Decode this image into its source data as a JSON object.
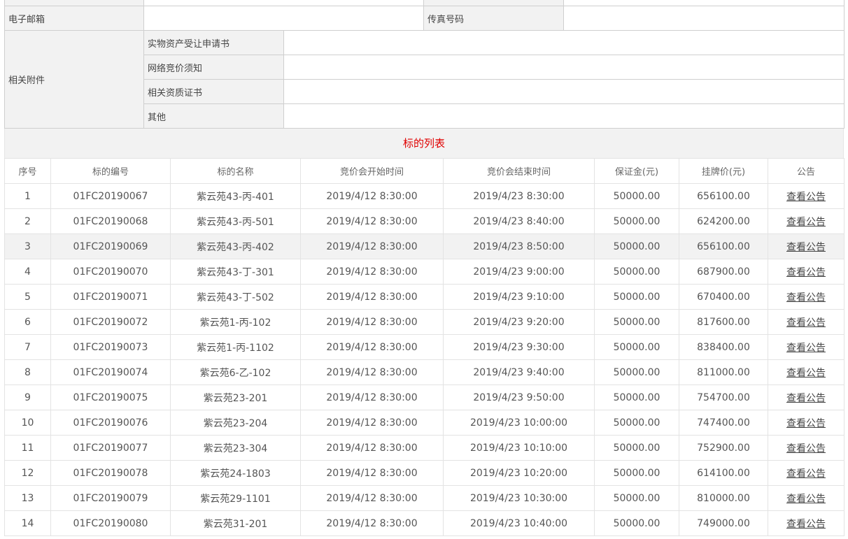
{
  "form": {
    "email_label": "电子邮箱",
    "email_value": "",
    "fax_label": "传真号码",
    "fax_value": "",
    "attachments_label": "相关附件",
    "attachments": [
      {
        "label": "实物资产受让申请书",
        "value": ""
      },
      {
        "label": "网络竞价须知",
        "value": ""
      },
      {
        "label": "相关资质证书",
        "value": ""
      },
      {
        "label": "其他",
        "value": ""
      }
    ]
  },
  "list": {
    "title": "标的列表",
    "headers": [
      "序号",
      "标的编号",
      "标的名称",
      "竞价会开始时间",
      "竞价会结束时间",
      "保证金(元)",
      "挂牌价(元)",
      "公告"
    ],
    "link_label": "查看公告",
    "rows": [
      {
        "no": "1",
        "code": "01FC20190067",
        "name": "紫云苑43-丙-401",
        "start": "2019/4/12 8:30:00",
        "end": "2019/4/23 8:30:00",
        "deposit": "50000.00",
        "price": "656100.00"
      },
      {
        "no": "2",
        "code": "01FC20190068",
        "name": "紫云苑43-丙-501",
        "start": "2019/4/12 8:30:00",
        "end": "2019/4/23 8:40:00",
        "deposit": "50000.00",
        "price": "624200.00"
      },
      {
        "no": "3",
        "code": "01FC20190069",
        "name": "紫云苑43-丙-402",
        "start": "2019/4/12 8:30:00",
        "end": "2019/4/23 8:50:00",
        "deposit": "50000.00",
        "price": "656100.00"
      },
      {
        "no": "4",
        "code": "01FC20190070",
        "name": "紫云苑43-丁-301",
        "start": "2019/4/12 8:30:00",
        "end": "2019/4/23 9:00:00",
        "deposit": "50000.00",
        "price": "687900.00"
      },
      {
        "no": "5",
        "code": "01FC20190071",
        "name": "紫云苑43-丁-502",
        "start": "2019/4/12 8:30:00",
        "end": "2019/4/23 9:10:00",
        "deposit": "50000.00",
        "price": "670400.00"
      },
      {
        "no": "6",
        "code": "01FC20190072",
        "name": "紫云苑1-丙-102",
        "start": "2019/4/12 8:30:00",
        "end": "2019/4/23 9:20:00",
        "deposit": "50000.00",
        "price": "817600.00"
      },
      {
        "no": "7",
        "code": "01FC20190073",
        "name": "紫云苑1-丙-1102",
        "start": "2019/4/12 8:30:00",
        "end": "2019/4/23 9:30:00",
        "deposit": "50000.00",
        "price": "838400.00"
      },
      {
        "no": "8",
        "code": "01FC20190074",
        "name": "紫云苑6-乙-102",
        "start": "2019/4/12 8:30:00",
        "end": "2019/4/23 9:40:00",
        "deposit": "50000.00",
        "price": "811000.00"
      },
      {
        "no": "9",
        "code": "01FC20190075",
        "name": "紫云苑23-201",
        "start": "2019/4/12 8:30:00",
        "end": "2019/4/23 9:50:00",
        "deposit": "50000.00",
        "price": "754700.00"
      },
      {
        "no": "10",
        "code": "01FC20190076",
        "name": "紫云苑23-204",
        "start": "2019/4/12 8:30:00",
        "end": "2019/4/23 10:00:00",
        "deposit": "50000.00",
        "price": "747400.00"
      },
      {
        "no": "11",
        "code": "01FC20190077",
        "name": "紫云苑23-304",
        "start": "2019/4/12 8:30:00",
        "end": "2019/4/23 10:10:00",
        "deposit": "50000.00",
        "price": "752900.00"
      },
      {
        "no": "12",
        "code": "01FC20190078",
        "name": "紫云苑24-1803",
        "start": "2019/4/12 8:30:00",
        "end": "2019/4/23 10:20:00",
        "deposit": "50000.00",
        "price": "614100.00"
      },
      {
        "no": "13",
        "code": "01FC20190079",
        "name": "紫云苑29-1101",
        "start": "2019/4/12 8:30:00",
        "end": "2019/4/23 10:30:00",
        "deposit": "50000.00",
        "price": "810000.00"
      },
      {
        "no": "14",
        "code": "01FC20190080",
        "name": "紫云苑31-201",
        "start": "2019/4/12 8:30:00",
        "end": "2019/4/23 10:40:00",
        "deposit": "50000.00",
        "price": "749000.00"
      }
    ]
  },
  "colors": {
    "title_red": "#e00000",
    "label_bg": "#f2f2f2",
    "border": "#cfcfcf",
    "highlight_row_bg": "#f2f2f2"
  }
}
